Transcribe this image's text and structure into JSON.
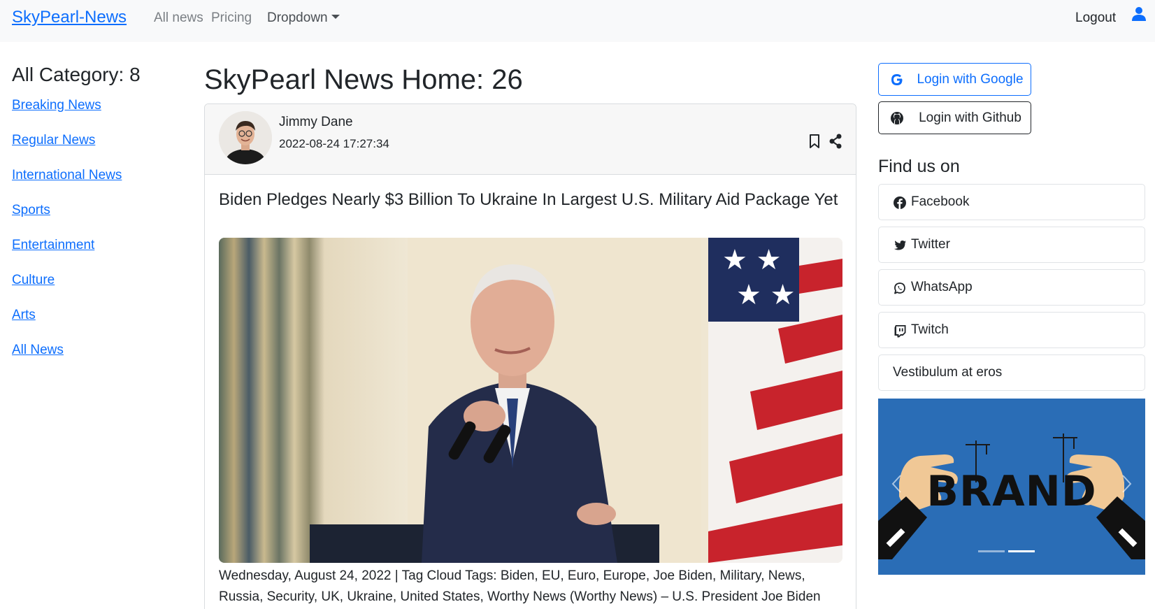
{
  "navbar": {
    "brand": "SkyPearl-News",
    "links": [
      "All news",
      "Pricing"
    ],
    "dropdown_label": "Dropdown",
    "logout": "Logout",
    "user_icon": "user-icon"
  },
  "sidebar": {
    "title": "All Category: 8",
    "categories": [
      "Breaking News",
      "Regular News",
      "International News",
      "Sports",
      "Entertainment",
      "Culture",
      "Arts",
      "All News"
    ]
  },
  "main": {
    "title": "SkyPearl News Home: 26",
    "post": {
      "author": "Jimmy Dane",
      "date": "2022-08-24 17:27:34",
      "headline": "Biden Pledges Nearly $3 Billion To Ukraine In Largest U.S. Military Aid Package Yet",
      "excerpt": "Wednesday, August 24, 2022 | Tag Cloud Tags: Biden, EU, Euro, Europe, Joe Biden, Military, News, Russia, Security, UK, Ukraine, United States, Worthy News (Worthy News) – U.S. President Joe Biden"
    }
  },
  "right": {
    "login_google": "Login with Google",
    "login_github": "Login with Github",
    "find_title": "Find us on",
    "social": [
      {
        "label": "Facebook",
        "icon": "facebook-icon"
      },
      {
        "label": "Twitter",
        "icon": "twitter-icon"
      },
      {
        "label": "WhatsApp",
        "icon": "whatsapp-icon"
      },
      {
        "label": "Twitch",
        "icon": "twitch-icon"
      },
      {
        "label": "Vestibulum at eros",
        "icon": ""
      }
    ],
    "carousel": {
      "word": "BRAND",
      "active_slide": 2,
      "slides": 2
    }
  },
  "colors": {
    "link": "#0d6efd",
    "navbar_bg": "#f8f9fa",
    "carousel_bg": "#2a6db6"
  }
}
